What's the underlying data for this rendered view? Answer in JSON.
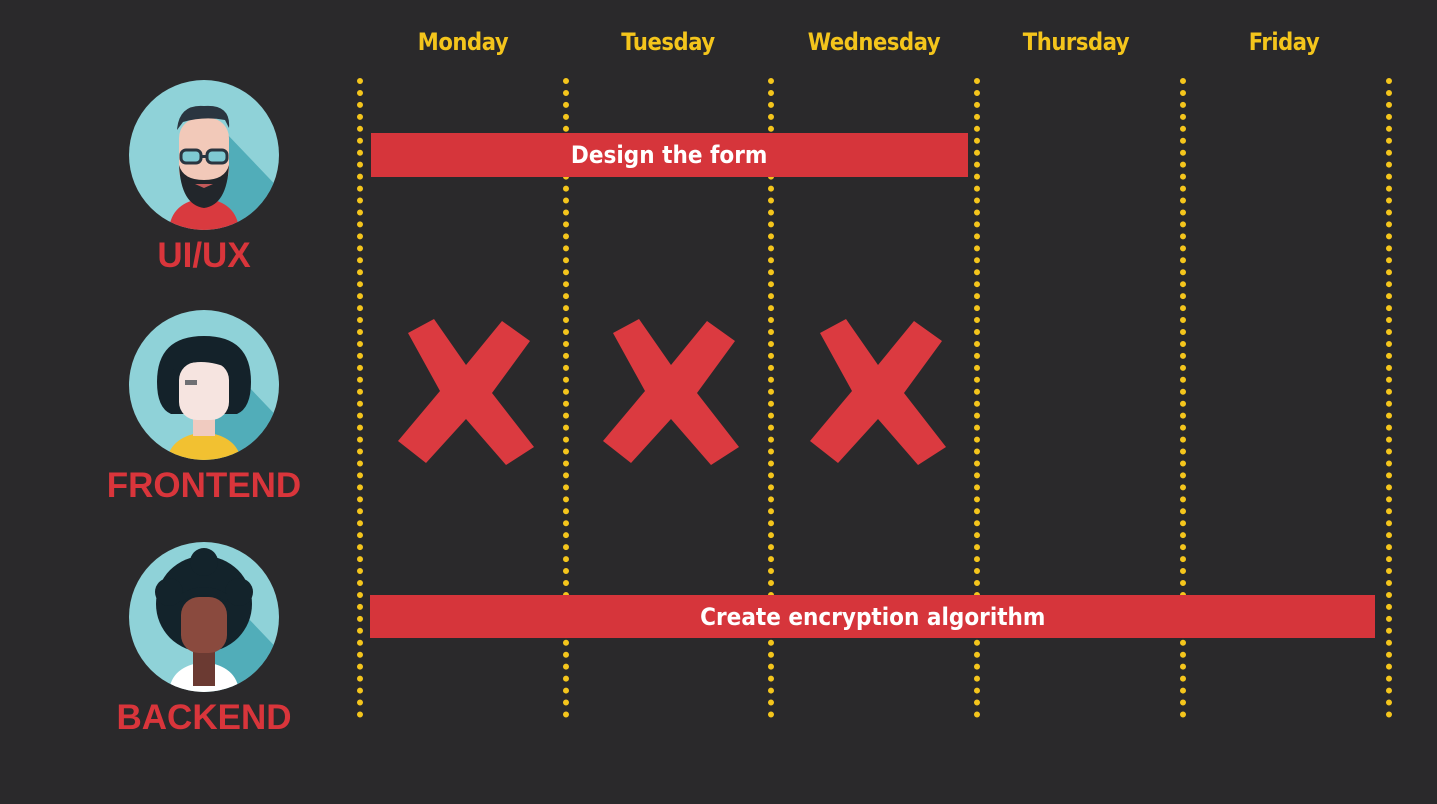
{
  "days": [
    "Monday",
    "Tuesday",
    "Wednesday",
    "Thursday",
    "Friday"
  ],
  "roles": {
    "uiux": "UI/UX",
    "frontend": "FRONTEND",
    "backend": "BACKEND"
  },
  "tasks": {
    "design": "Design the form",
    "encryption": "Create encryption algorithm"
  },
  "blocked_days_frontend": [
    "Monday",
    "Tuesday",
    "Wednesday"
  ],
  "colors": {
    "background": "#2a292b",
    "accent_yellow": "#f4c51c",
    "accent_red": "#d6353b",
    "avatar_bg": "#8fd2d8"
  }
}
